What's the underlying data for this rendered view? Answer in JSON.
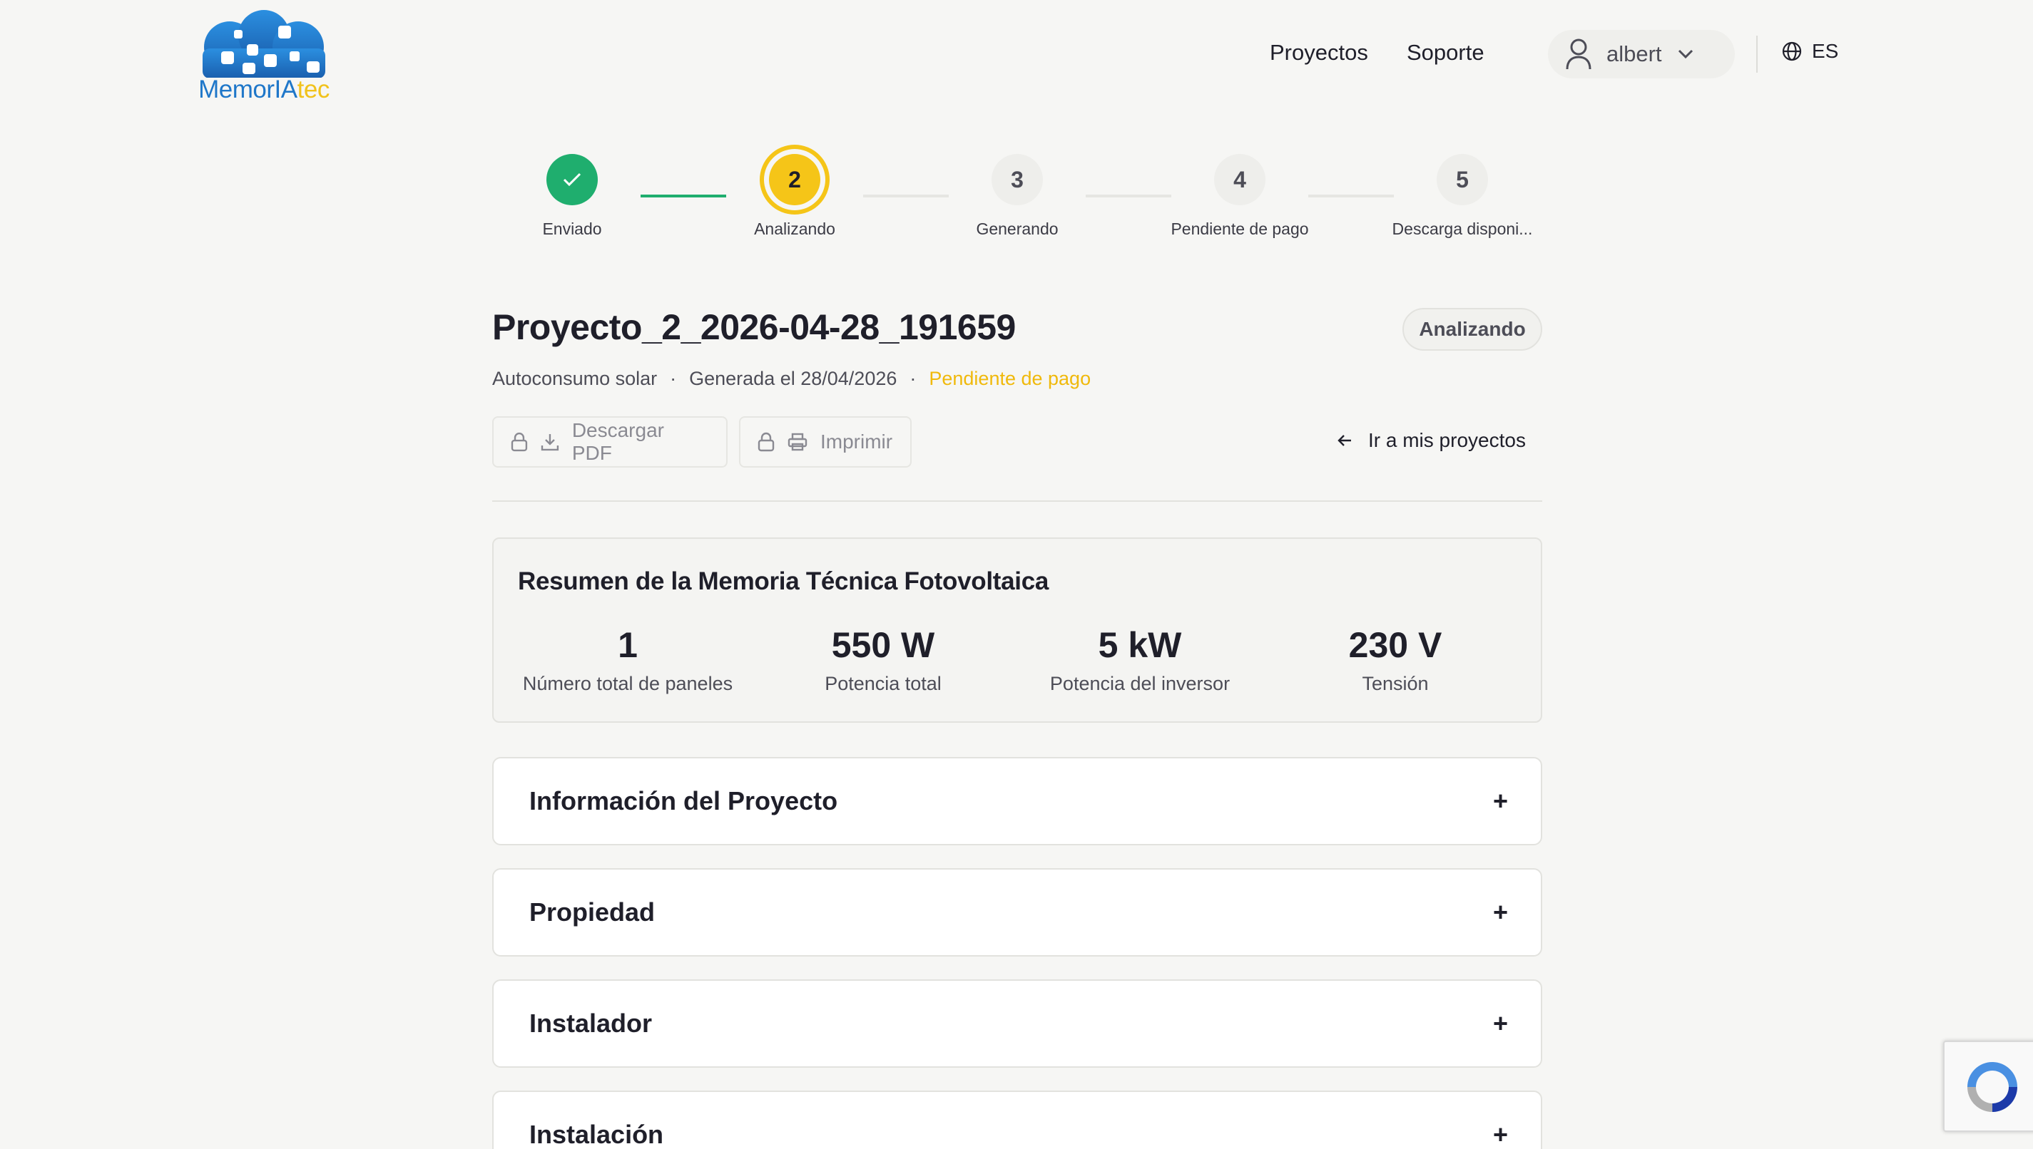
{
  "brand": {
    "part1": "MemorIA",
    "part2": "tec"
  },
  "nav": {
    "projects": "Proyectos",
    "support": "Soporte"
  },
  "user": {
    "name": "albert"
  },
  "language": "ES",
  "stepper": [
    {
      "number": "1",
      "label": "Enviado",
      "state": "done"
    },
    {
      "number": "2",
      "label": "Analizando",
      "state": "active"
    },
    {
      "number": "3",
      "label": "Generando",
      "state": "pending"
    },
    {
      "number": "4",
      "label": "Pendiente de pago",
      "state": "pending"
    },
    {
      "number": "5",
      "label": "Descarga disponi...",
      "state": "pending"
    }
  ],
  "project": {
    "title": "Proyecto_2_2026-04-28_191659",
    "status": "Analizando",
    "type": "Autoconsumo solar",
    "generated": "Generada el 28/04/2026",
    "payment_status": "Pendiente de pago",
    "separator": "·"
  },
  "actions": {
    "download_pdf": "Descargar PDF",
    "print": "Imprimir",
    "back": "Ir a mis proyectos"
  },
  "summary": {
    "title": "Resumen de la Memoria Técnica Fotovoltaica",
    "stats": [
      {
        "value": "1",
        "label": "Número total de paneles"
      },
      {
        "value": "550 W",
        "label": "Potencia total"
      },
      {
        "value": "5 kW",
        "label": "Potencia del inversor"
      },
      {
        "value": "230 V",
        "label": "Tensión"
      }
    ]
  },
  "sections": [
    {
      "title": "Información del Proyecto"
    },
    {
      "title": "Propiedad"
    },
    {
      "title": "Instalador"
    },
    {
      "title": "Instalación"
    }
  ],
  "colors": {
    "done": "#1fae6e",
    "active": "#f5c518",
    "pending_text": "#f0b90b",
    "brand_blue": "#1f77c9",
    "brand_yellow": "#f1c21b"
  }
}
